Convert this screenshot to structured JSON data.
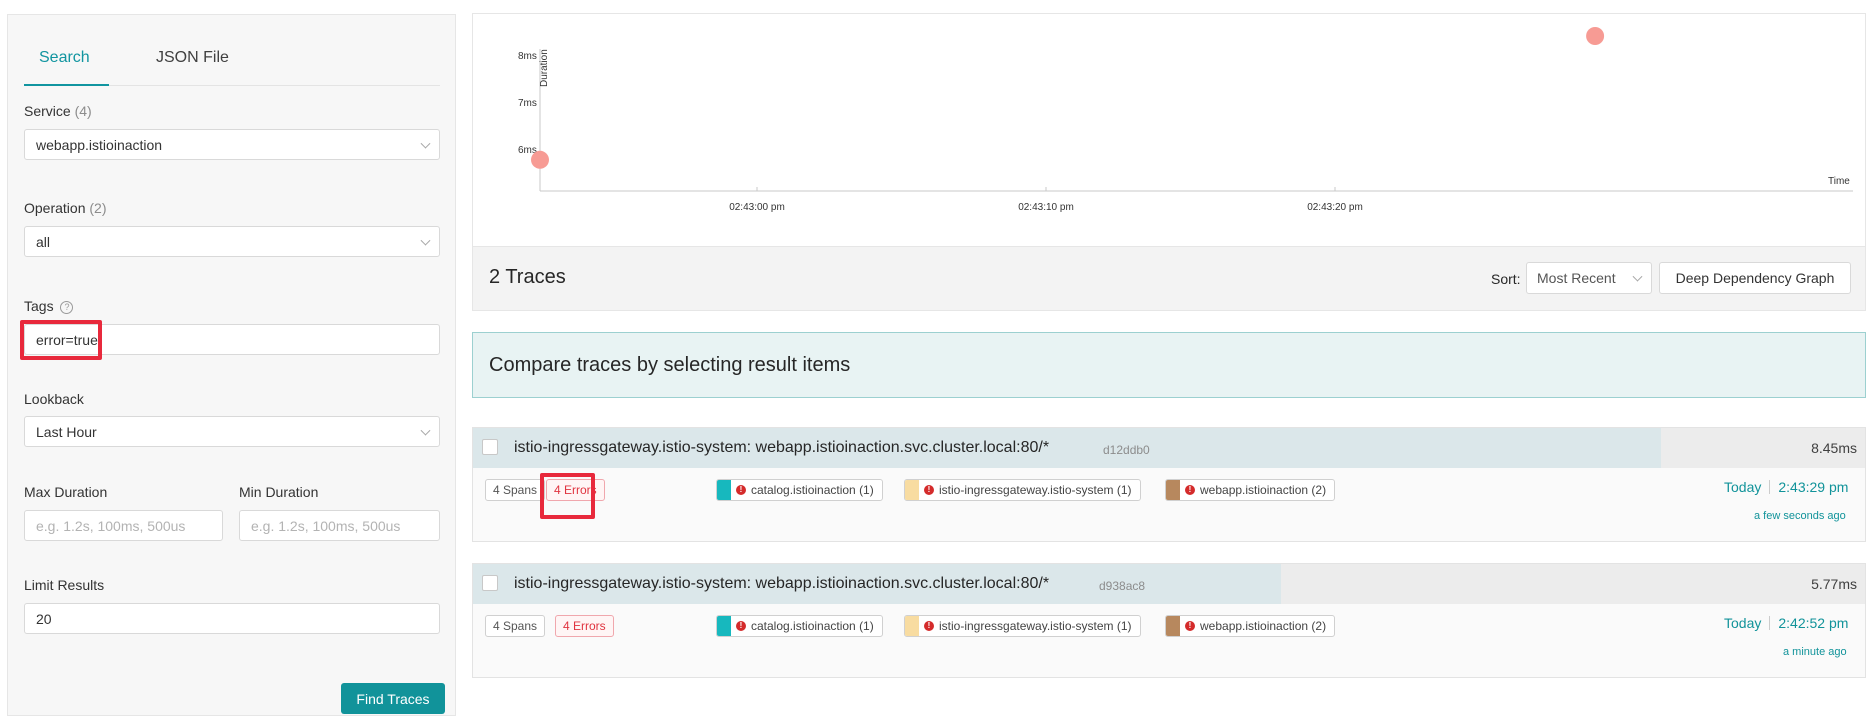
{
  "search_panel": {
    "tabs": [
      "Search",
      "JSON File"
    ],
    "service": {
      "label": "Service",
      "count": "(4)",
      "value": "webapp.istioinaction"
    },
    "operation": {
      "label": "Operation",
      "count": "(2)",
      "value": "all"
    },
    "tags": {
      "label": "Tags",
      "help": "?",
      "value": "error=true"
    },
    "lookback": {
      "label": "Lookback",
      "value": "Last Hour"
    },
    "max_duration": {
      "label": "Max Duration",
      "placeholder": "e.g. 1.2s, 100ms, 500us"
    },
    "min_duration": {
      "label": "Min Duration",
      "placeholder": "e.g. 1.2s, 100ms, 500us"
    },
    "limit": {
      "label": "Limit Results",
      "value": "20"
    },
    "find_button": "Find Traces"
  },
  "scatter": {
    "y_label": "Duration",
    "x_label": "Time",
    "y_ticks": [
      "8ms",
      "7ms",
      "6ms"
    ],
    "x_ticks": [
      "02:43:00 pm",
      "02:43:10 pm",
      "02:43:20 pm"
    ],
    "point_color": "#f79b94",
    "points": [
      {
        "time": "02:42:52 pm",
        "duration_ms": 5.77
      },
      {
        "time": "02:43:29 pm",
        "duration_ms": 8.45
      }
    ]
  },
  "results": {
    "title": "2 Traces",
    "sort_label": "Sort:",
    "sort_value": "Most Recent",
    "ddg_button": "Deep Dependency Graph",
    "compare_text": "Compare traces by selecting result items"
  },
  "traces": [
    {
      "name": "istio-ingressgateway.istio-system: webapp.istioinaction.svc.cluster.local:80/*",
      "id": "d12ddb0",
      "duration": "8.45ms",
      "duration_fraction": 1.0,
      "spans": "4 Spans",
      "errors": "4 Errors",
      "services": [
        {
          "label": "catalog.istioinaction (1)",
          "color": "#17b8be"
        },
        {
          "label": "istio-ingressgateway.istio-system (1)",
          "color": "#f8dca1"
        },
        {
          "label": "webapp.istioinaction (2)",
          "color": "#b7885e"
        }
      ],
      "day": "Today",
      "time": "2:43:29 pm",
      "ago": "a few seconds ago"
    },
    {
      "name": "istio-ingressgateway.istio-system: webapp.istioinaction.svc.cluster.local:80/*",
      "id": "d938ac8",
      "duration": "5.77ms",
      "duration_fraction": 0.68,
      "spans": "4 Spans",
      "errors": "4 Errors",
      "services": [
        {
          "label": "catalog.istioinaction (1)",
          "color": "#17b8be"
        },
        {
          "label": "istio-ingressgateway.istio-system (1)",
          "color": "#f8dca1"
        },
        {
          "label": "webapp.istioinaction (2)",
          "color": "#b7885e"
        }
      ],
      "day": "Today",
      "time": "2:42:52 pm",
      "ago": "a minute ago"
    }
  ],
  "accent_color": "#11939a",
  "highlight_color": "#e8293c"
}
